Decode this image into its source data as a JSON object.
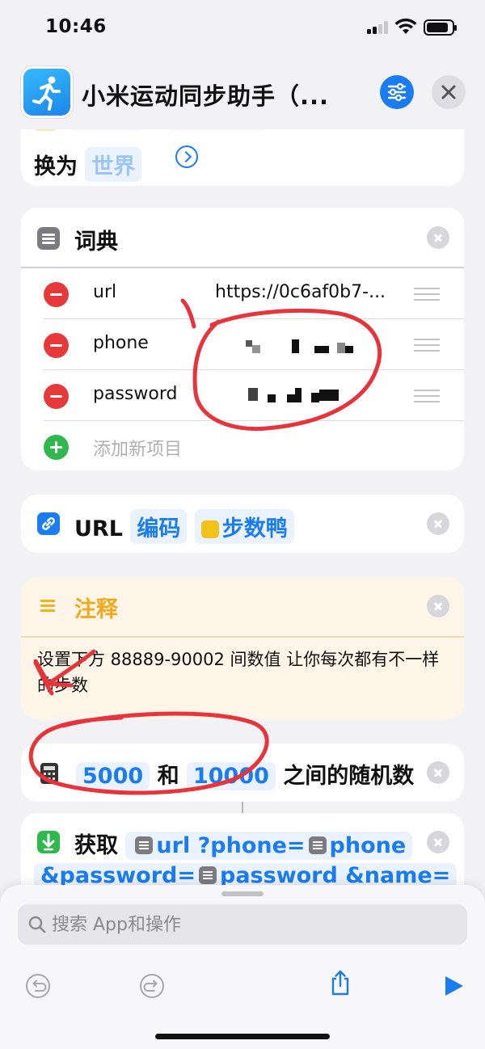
{
  "status_bar": {
    "time": "10:46"
  },
  "header": {
    "title": "小米运动同步助手（..."
  },
  "card_conversion": {
    "prefix": "换为",
    "value": "世界"
  },
  "dictionary": {
    "title": "词典",
    "rows": [
      {
        "key": "url",
        "value": "https://0c6af0b7-..."
      },
      {
        "key": "phone",
        "value": ""
      },
      {
        "key": "password",
        "value": ""
      }
    ],
    "add_label": "添加新项目"
  },
  "url_encode": {
    "label": "URL",
    "action": "编码",
    "variable": "步数鸭"
  },
  "comment": {
    "title": "注释",
    "body": "设置下方 88889-90002 间数值 让你每次都有不一样的步数"
  },
  "random": {
    "min": "5000",
    "and": "和",
    "max": "10000",
    "suffix": "之间的随机数"
  },
  "get": {
    "label": "获取",
    "var_url": "url",
    "q_phone": "?phone=",
    "var_phone": "phone",
    "q_password": "&password=",
    "var_password": "password",
    "q_name": "&name="
  },
  "search": {
    "placeholder": "搜索 App和操作"
  },
  "colors": {
    "accent": "#1a7cf0",
    "delete": "#e8393a",
    "add": "#2fb94c",
    "comment": "#f2a81a",
    "annotation": "#e8333a"
  }
}
